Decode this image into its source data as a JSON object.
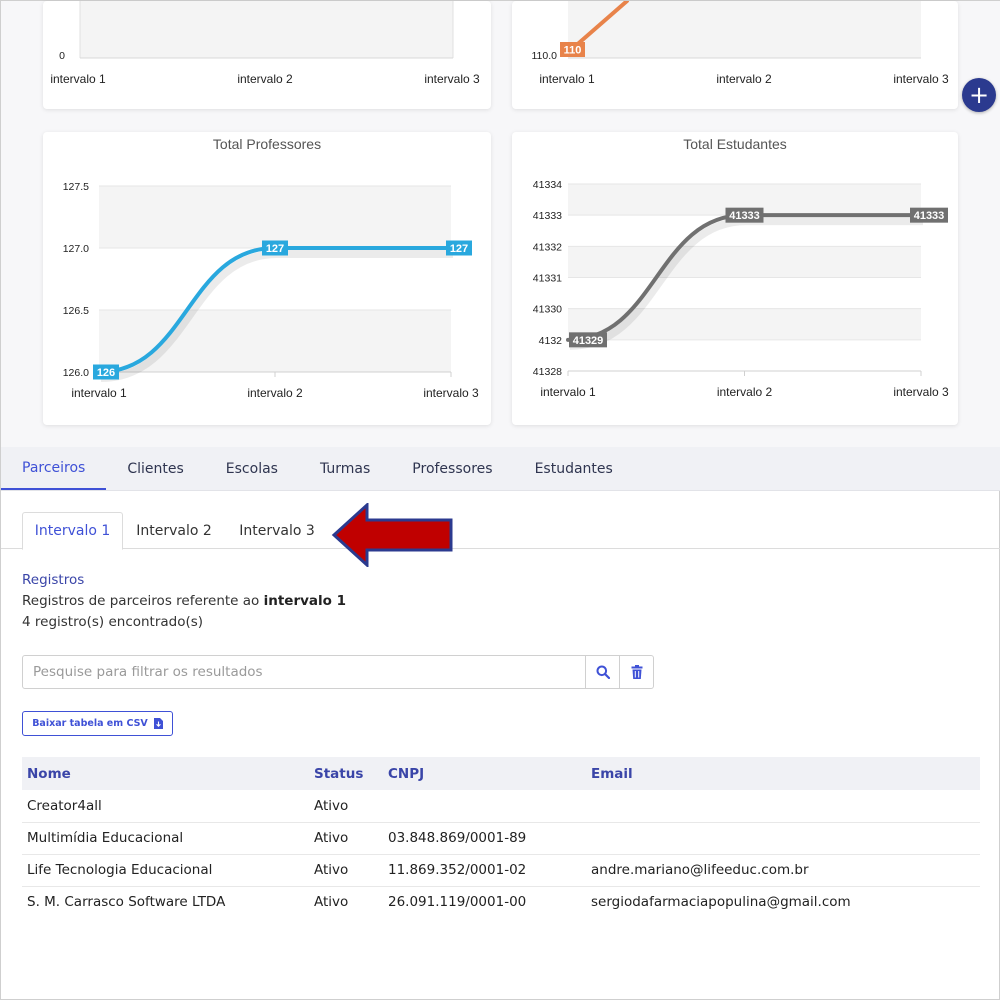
{
  "charts_top": {
    "left": {
      "y_min_label": "0",
      "x_ticks": [
        "intervalo 1",
        "intervalo 2",
        "intervalo 3"
      ]
    },
    "right": {
      "y_min_label": "110.0",
      "first_value_label": "110",
      "x_ticks": [
        "intervalo 1",
        "intervalo 2",
        "intervalo 3"
      ]
    }
  },
  "chart_data": [
    {
      "type": "line",
      "title": "Total Professores",
      "categories": [
        "intervalo 1",
        "intervalo 2",
        "intervalo 3"
      ],
      "values": [
        126,
        127,
        127
      ],
      "value_labels": [
        "126",
        "127",
        "127"
      ],
      "ylim": [
        126.0,
        127.5
      ],
      "y_ticks": [
        "127.5",
        "127.0",
        "126.5",
        "126.0"
      ],
      "y_tick_values": [
        127.5,
        127.0,
        126.5,
        126.0
      ],
      "color": "#29a8de",
      "grid": true
    },
    {
      "type": "line",
      "title": "Total Estudantes",
      "categories": [
        "intervalo 1",
        "intervalo 2",
        "intervalo 3"
      ],
      "values": [
        41329,
        41333,
        41333
      ],
      "value_labels": [
        "41329",
        "41333",
        "41333"
      ],
      "ylim": [
        41328,
        41334
      ],
      "y_ticks": [
        "41334",
        "41333",
        "41332",
        "41331",
        "41330",
        "4132",
        "41328"
      ],
      "y_tick_values": [
        41334,
        41333,
        41332,
        41331,
        41330,
        41329,
        41328
      ],
      "color": "#707070",
      "grid": true
    }
  ],
  "fab": {
    "label": "+"
  },
  "main_tabs": [
    {
      "label": "Parceiros",
      "active": true
    },
    {
      "label": "Clientes"
    },
    {
      "label": "Escolas"
    },
    {
      "label": "Turmas"
    },
    {
      "label": "Professores"
    },
    {
      "label": "Estudantes"
    }
  ],
  "sub_tabs": [
    {
      "label": "Intervalo 1",
      "active": true
    },
    {
      "label": "Intervalo 2"
    },
    {
      "label": "Intervalo 3"
    }
  ],
  "registros": {
    "title": "Registros",
    "description_prefix": "Registros de parceiros referente ao",
    "description_bold": "intervalo 1",
    "count_text": "4 registro(s) encontrado(s)"
  },
  "search": {
    "placeholder": "Pesquise para filtrar os resultados",
    "value": ""
  },
  "csv_button": {
    "label": "Baixar tabela em CSV"
  },
  "table": {
    "headers": [
      "Nome",
      "Status",
      "CNPJ",
      "Email"
    ],
    "rows": [
      [
        "Creator4all",
        "Ativo",
        "",
        ""
      ],
      [
        "Multimídia Educacional",
        "Ativo",
        "03.848.869/0001-89",
        ""
      ],
      [
        "Life Tecnologia Educacional",
        "Ativo",
        "11.869.352/0001-02",
        "andre.mariano@lifeeduc.com.br"
      ],
      [
        "S. M. Carrasco Software LTDA",
        "Ativo",
        "26.091.119/0001-00",
        "sergiodafarmaciapopulina@gmail.com"
      ]
    ]
  },
  "colors": {
    "accent": "#3f51d6",
    "header_text": "#3a45a8",
    "fab": "#2b3a8f",
    "arrow": "#c00000",
    "arrow_border": "#2b3a8f",
    "top_partial_label": "#e8834a"
  }
}
